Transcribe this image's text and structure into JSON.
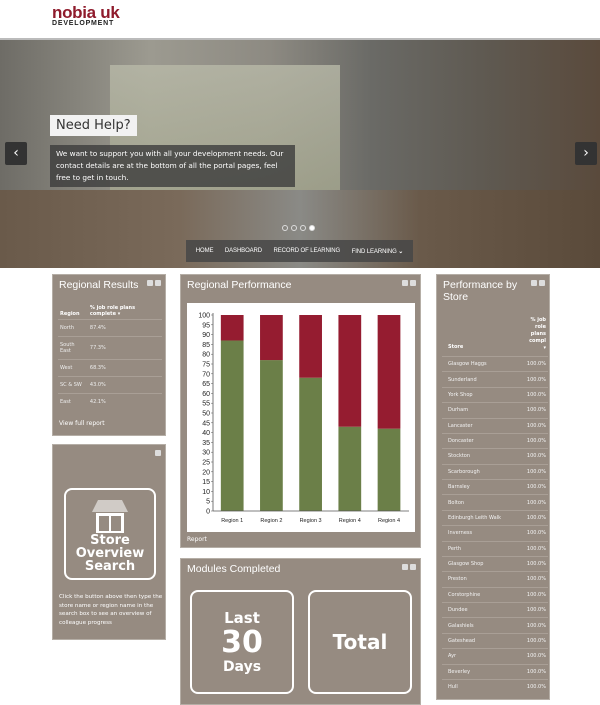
{
  "logo": {
    "line1": "nobia uk",
    "line2": "DEVELOPMENT"
  },
  "hero": {
    "title": "Need Help?",
    "text": "We want to support you with all your development needs. Our contact details are at the bottom of all the portal pages, feel free to get in touch.",
    "prev_icon": "chevron-left",
    "next_icon": "chevron-right",
    "slides": 4,
    "active_slide": 4
  },
  "nav": [
    {
      "label": "HOME"
    },
    {
      "label": "DASHBOARD"
    },
    {
      "label": "RECORD OF LEARNING"
    },
    {
      "label": "FIND LEARNING"
    }
  ],
  "regional_results": {
    "title": "Regional Results",
    "col1": "Region",
    "col2": "% job role plans complete",
    "rows": [
      [
        "North",
        "87.4%"
      ],
      [
        "South East",
        "77.3%"
      ],
      [
        "West",
        "68.3%"
      ],
      [
        "SC & SW",
        "43.0%"
      ],
      [
        "East",
        "42.1%"
      ]
    ],
    "link": "View full report"
  },
  "store_overview": {
    "button": "Store Overview Search",
    "help": "Click the button above then type the store name or region name in the search box to see an overview of colleague progress"
  },
  "regional_performance": {
    "title": "Regional Performance",
    "link": "Report"
  },
  "chart_data": {
    "type": "bar",
    "stacked": true,
    "categories": [
      "Region 1",
      "Region 2",
      "Region 3",
      "Region 4",
      "Region 4"
    ],
    "series": [
      {
        "values": [
          87,
          77,
          68,
          43,
          42
        ],
        "color": "#6b7f48"
      },
      {
        "values": [
          13,
          23,
          32,
          57,
          58
        ],
        "color": "#951c30"
      }
    ],
    "ylim": [
      0,
      100
    ],
    "yticks": [
      0,
      5,
      10,
      15,
      20,
      25,
      30,
      35,
      40,
      45,
      50,
      55,
      60,
      65,
      70,
      75,
      80,
      85,
      90,
      95,
      100
    ]
  },
  "modules": {
    "title": "Modules Completed",
    "last": "Last",
    "num": "30",
    "days": "Days",
    "total": "Total"
  },
  "performance_by_store": {
    "title": "Performance by Store",
    "col1": "Store",
    "col2": "% job role plans compl",
    "rows": [
      [
        "Glasgow Haggs",
        "100.0%"
      ],
      [
        "Sunderland",
        "100.0%"
      ],
      [
        "York Shop",
        "100.0%"
      ],
      [
        "Durham",
        "100.0%"
      ],
      [
        "Lancaster",
        "100.0%"
      ],
      [
        "Doncaster",
        "100.0%"
      ],
      [
        "Stockton",
        "100.0%"
      ],
      [
        "Scarborough",
        "100.0%"
      ],
      [
        "Barnsley",
        "100.0%"
      ],
      [
        "Bolton",
        "100.0%"
      ],
      [
        "Edinburgh Leith Walk",
        "100.0%"
      ],
      [
        "Inverness",
        "100.0%"
      ],
      [
        "Perth",
        "100.0%"
      ],
      [
        "Glasgow Shop",
        "100.0%"
      ],
      [
        "Preston",
        "100.0%"
      ],
      [
        "Corstorphine",
        "100.0%"
      ],
      [
        "Dundee",
        "100.0%"
      ],
      [
        "Galashiels",
        "100.0%"
      ],
      [
        "Gateshead",
        "100.0%"
      ],
      [
        "Ayr",
        "100.0%"
      ],
      [
        "Beverley",
        "100.0%"
      ],
      [
        "Hull",
        "100.0%"
      ]
    ]
  }
}
